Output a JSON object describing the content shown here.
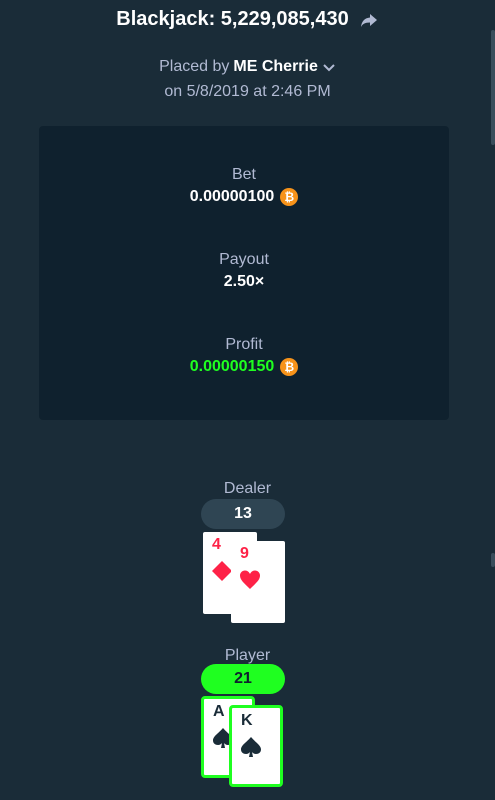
{
  "header": {
    "title": "Blackjack: 5,229,085,430",
    "placed_prefix": "Placed by",
    "username": "ME Cherrie",
    "date": "on 5/8/2019 at 2:46 PM"
  },
  "stats": {
    "bet_label": "Bet",
    "bet_value": "0.00000100",
    "payout_label": "Payout",
    "payout_value": "2.50×",
    "profit_label": "Profit",
    "profit_value": "0.00000150",
    "currency_symbol": "₿"
  },
  "dealer": {
    "label": "Dealer",
    "total": "13",
    "cards": [
      {
        "rank": "4",
        "suit": "diamond"
      },
      {
        "rank": "9",
        "suit": "heart"
      }
    ]
  },
  "player": {
    "label": "Player",
    "total": "21",
    "cards": [
      {
        "rank": "A",
        "suit": "spade"
      },
      {
        "rank": "K",
        "suit": "spade"
      }
    ]
  },
  "colors": {
    "background": "#1a2c38",
    "panel": "#0f212e",
    "win_green": "#1fff20",
    "red_suit": "#fe2247",
    "bitcoin": "#f7931a"
  }
}
